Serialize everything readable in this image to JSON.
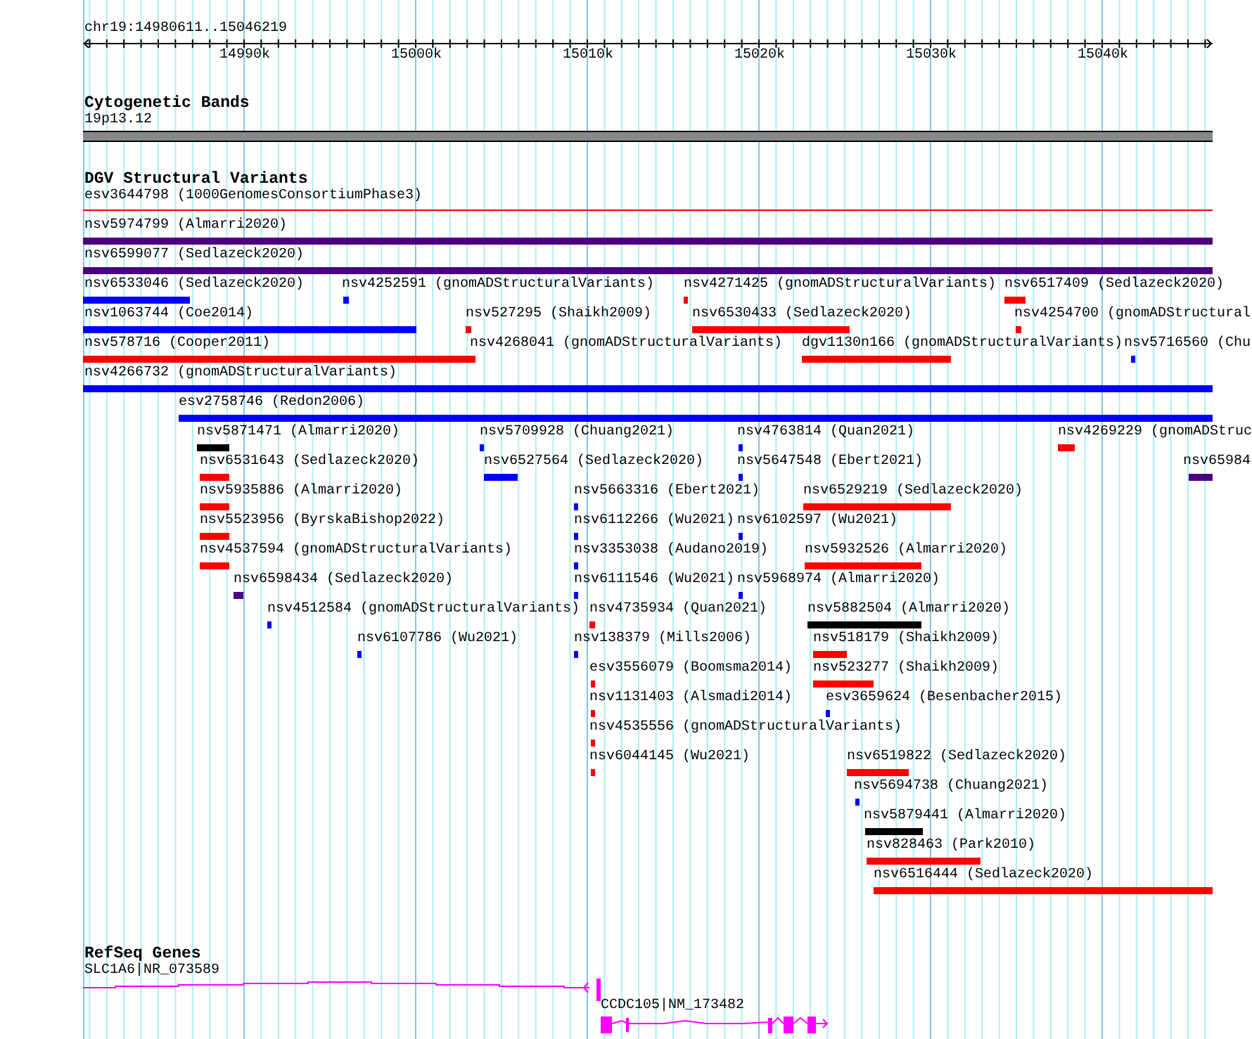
{
  "ruler": {
    "position": "chr19:14980611..15046219",
    "ticks": [
      "14990k",
      "15000k",
      "15010k",
      "15020k",
      "15030k",
      "15040k"
    ]
  },
  "cytogenetic_bands": {
    "title": "Cytogenetic Bands",
    "band": "19p13.12"
  },
  "dgv_structural_variants": {
    "title": "DGV Structural Variants",
    "features": [
      {
        "label": "esv3644798 (1000GenomesConsortiumPhase3)",
        "color": "#ff0000"
      },
      {
        "label": "nsv5974799 (Almarri2020)",
        "color": "#4b0082"
      },
      {
        "label": "nsv6599077 (Sedlazeck2020)",
        "color": "#4b0082"
      },
      {
        "label": "nsv6533046 (Sedlazeck2020)",
        "color": "#0000ff"
      },
      {
        "label": "nsv4252591 (gnomADStructuralVariants)",
        "color": "#0000ff"
      },
      {
        "label": "nsv4271425 (gnomADStructuralVariants)",
        "color": "#ff0000"
      },
      {
        "label": "nsv6517409 (Sedlazeck2020)",
        "color": "#ff0000"
      },
      {
        "label": "nsv1063744 (Coe2014)",
        "color": "#0000ff"
      },
      {
        "label": "nsv527295 (Shaikh2009)",
        "color": "#ff0000"
      },
      {
        "label": "nsv6530433 (Sedlazeck2020)",
        "color": "#ff0000"
      },
      {
        "label": "nsv4254700 (gnomADStructural",
        "color": "#ff0000"
      },
      {
        "label": "nsv578716 (Cooper2011)",
        "color": "#ff0000"
      },
      {
        "label": "nsv4268041 (gnomADStructuralVariants)",
        "color": "#ff0000"
      },
      {
        "label": "dgv1130n166 (gnomADStructuralVariants)",
        "color": "#ff0000"
      },
      {
        "label": "nsv5716560 (Chu",
        "color": "#0000ff"
      },
      {
        "label": "nsv4266732 (gnomADStructuralVariants)",
        "color": "#0000ff"
      },
      {
        "label": "esv2758746 (Redon2006)",
        "color": "#0000ff"
      },
      {
        "label": "nsv5871471 (Almarri2020)",
        "color": "#000000"
      },
      {
        "label": "nsv5709928 (Chuang2021)",
        "color": "#0000ff"
      },
      {
        "label": "nsv4763814 (Quan2021)",
        "color": "#0000ff"
      },
      {
        "label": "nsv4269229 (gnomADStruc",
        "color": "#ff0000"
      },
      {
        "label": "nsv6531643 (Sedlazeck2020)",
        "color": "#ff0000"
      },
      {
        "label": "nsv6527564 (Sedlazeck2020)",
        "color": "#0000ff"
      },
      {
        "label": "nsv5647548 (Ebert2021)",
        "color": "#0000ff"
      },
      {
        "label": "nsv65984",
        "color": "#4b0082"
      },
      {
        "label": "nsv5935886 (Almarri2020)",
        "color": "#ff0000"
      },
      {
        "label": "nsv5663316 (Ebert2021)",
        "color": "#0000ff"
      },
      {
        "label": "nsv6529219 (Sedlazeck2020)",
        "color": "#ff0000"
      },
      {
        "label": "nsv5523956 (ByrskaBishop2022)",
        "color": "#ff0000"
      },
      {
        "label": "nsv6112266 (Wu2021)",
        "color": "#0000ff"
      },
      {
        "label": "nsv6102597 (Wu2021)",
        "color": "#0000ff"
      },
      {
        "label": "nsv4537594 (gnomADStructuralVariants)",
        "color": "#ff0000"
      },
      {
        "label": "nsv3353038 (Audano2019)",
        "color": "#0000ff"
      },
      {
        "label": "nsv5932526 (Almarri2020)",
        "color": "#ff0000"
      },
      {
        "label": "nsv6598434 (Sedlazeck2020)",
        "color": "#4b0082"
      },
      {
        "label": "nsv6111546 (Wu2021)",
        "color": "#0000ff"
      },
      {
        "label": "nsv5968974 (Almarri2020)",
        "color": "#0000ff"
      },
      {
        "label": "nsv4512584 (gnomADStructuralVariants)",
        "color": "#0000ff"
      },
      {
        "label": "nsv4735934 (Quan2021)",
        "color": "#ff0000"
      },
      {
        "label": "nsv5882504 (Almarri2020)",
        "color": "#000000"
      },
      {
        "label": "nsv6107786 (Wu2021)",
        "color": "#0000ff"
      },
      {
        "label": "nsv138379 (Mills2006)",
        "color": "#0000ff"
      },
      {
        "label": "nsv518179 (Shaikh2009)",
        "color": "#ff0000"
      },
      {
        "label": "esv3556079 (Boomsma2014)",
        "color": "#ff0000"
      },
      {
        "label": "nsv523277 (Shaikh2009)",
        "color": "#ff0000"
      },
      {
        "label": "nsv1131403 (Alsmadi2014)",
        "color": "#ff0000"
      },
      {
        "label": "esv3659624 (Besenbacher2015)",
        "color": "#0000ff"
      },
      {
        "label": "nsv4535556 (gnomADStructuralVariants)",
        "color": "#ff0000"
      },
      {
        "label": "nsv6044145 (Wu2021)",
        "color": "#ff0000"
      },
      {
        "label": "nsv6519822 (Sedlazeck2020)",
        "color": "#ff0000"
      },
      {
        "label": "nsv5694738 (Chuang2021)",
        "color": "#0000ff"
      },
      {
        "label": "nsv5879441 (Almarri2020)",
        "color": "#000000"
      },
      {
        "label": "nsv828463 (Park2010)",
        "color": "#ff0000"
      },
      {
        "label": "nsv6516444 (Sedlazeck2020)",
        "color": "#ff0000"
      }
    ]
  },
  "refseq_genes": {
    "title": "RefSeq Genes",
    "genes": [
      {
        "label": "SLC1A6|NR_073589"
      },
      {
        "label": "CCDC105|NM_173482"
      }
    ]
  }
}
